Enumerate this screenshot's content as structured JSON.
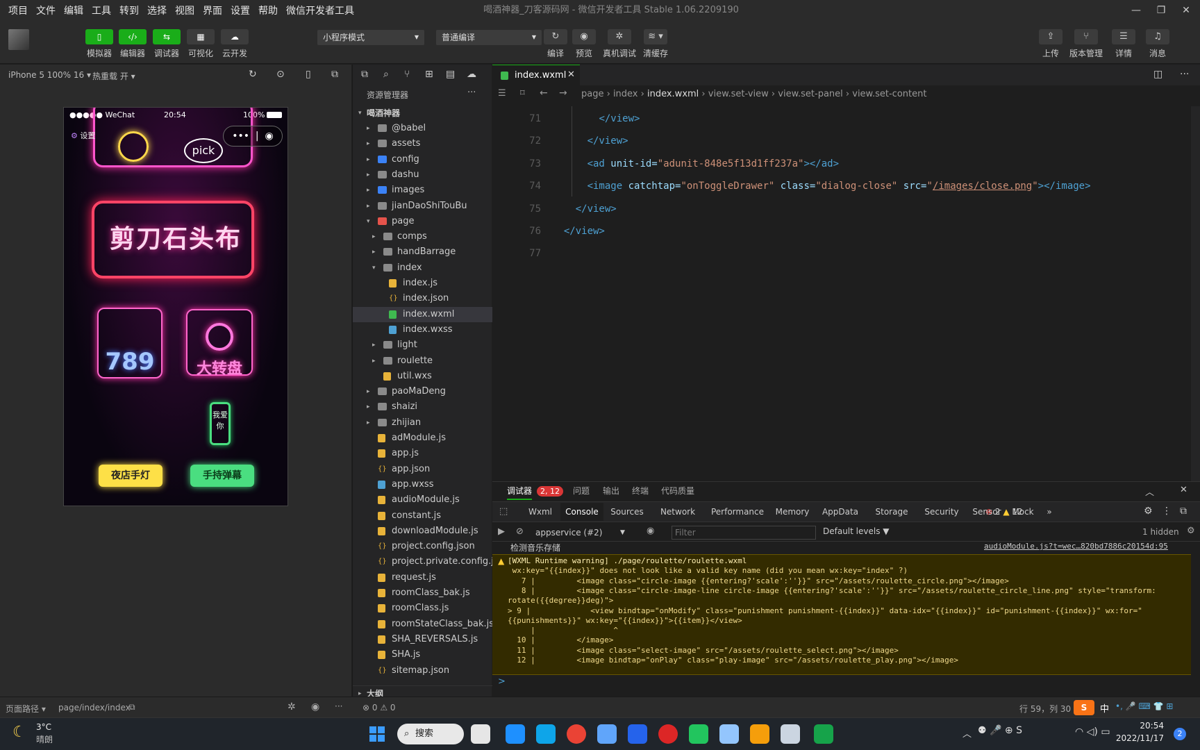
{
  "menubar": {
    "items": [
      "项目",
      "文件",
      "编辑",
      "工具",
      "转到",
      "选择",
      "视图",
      "界面",
      "设置",
      "帮助",
      "微信开发者工具"
    ]
  },
  "window": {
    "title": "喝酒神器_刀客源码网 - 微信开发者工具 Stable 1.06.2209190",
    "controls": [
      "—",
      "❐",
      "✕"
    ]
  },
  "toolbar": {
    "left_buttons": [
      {
        "label": "模拟器",
        "icon": "phone-icon",
        "color": "#1aad19"
      },
      {
        "label": "编辑器",
        "icon": "code-icon",
        "color": "#1aad19"
      },
      {
        "label": "调试器",
        "icon": "debug-icon",
        "color": "#1aad19"
      },
      {
        "label": "可视化",
        "icon": "layout-icon",
        "color": "#3c3c3c"
      },
      {
        "label": "云开发",
        "icon": "cloud-icon",
        "color": "#3c3c3c"
      }
    ],
    "mode_select": "小程序模式",
    "compile_select": "普通编译",
    "mid_buttons": [
      {
        "label": "编译",
        "icon": "refresh-icon"
      },
      {
        "label": "预览",
        "icon": "eye-icon"
      },
      {
        "label": "真机调试",
        "icon": "bug-icon"
      },
      {
        "label": "清缓存",
        "icon": "layers-icon"
      }
    ],
    "right_buttons": [
      {
        "label": "上传",
        "icon": "upload-icon"
      },
      {
        "label": "版本管理",
        "icon": "branch-icon"
      },
      {
        "label": "详情",
        "icon": "menu-icon"
      },
      {
        "label": "消息",
        "icon": "bell-icon"
      }
    ]
  },
  "simulator": {
    "device": "iPhone 5 100% 16",
    "hot_reload": "热重载 开",
    "status_carrier": "●●●●● WeChat",
    "status_time": "20:54",
    "status_battery": "100%",
    "settings_label": "设置",
    "pick_label": "pick",
    "banner_text": "剪刀石头布",
    "dice_text": "789",
    "wheel_text": "大转盘",
    "btn_light": "夜店手灯",
    "btn_barrage": "手持弹幕",
    "phone_text": "我爱你"
  },
  "explorer": {
    "title": "资源管理器",
    "more": "···",
    "root": "喝酒神器",
    "items": [
      {
        "label": "@babel",
        "type": "folder",
        "depth": 1,
        "arrow": "▸"
      },
      {
        "label": "assets",
        "type": "folder",
        "depth": 1,
        "arrow": "▸"
      },
      {
        "label": "config",
        "type": "folder-blue",
        "depth": 1,
        "arrow": "▸"
      },
      {
        "label": "dashu",
        "type": "folder",
        "depth": 1,
        "arrow": "▸"
      },
      {
        "label": "images",
        "type": "folder-blue",
        "depth": 1,
        "arrow": "▸"
      },
      {
        "label": "jianDaoShiTouBu",
        "type": "folder",
        "depth": 1,
        "arrow": "▸"
      },
      {
        "label": "page",
        "type": "folder-red",
        "depth": 1,
        "arrow": "▾"
      },
      {
        "label": "comps",
        "type": "folder",
        "depth": 2,
        "arrow": "▸"
      },
      {
        "label": "handBarrage",
        "type": "folder",
        "depth": 2,
        "arrow": "▸"
      },
      {
        "label": "index",
        "type": "folder",
        "depth": 2,
        "arrow": "▾"
      },
      {
        "label": "index.js",
        "type": "js",
        "depth": 3,
        "arrow": ""
      },
      {
        "label": "index.json",
        "type": "json",
        "depth": 3,
        "arrow": ""
      },
      {
        "label": "index.wxml",
        "type": "wxml",
        "depth": 3,
        "arrow": "",
        "selected": true
      },
      {
        "label": "index.wxss",
        "type": "wxss",
        "depth": 3,
        "arrow": ""
      },
      {
        "label": "light",
        "type": "folder",
        "depth": 2,
        "arrow": "▸"
      },
      {
        "label": "roulette",
        "type": "folder",
        "depth": 2,
        "arrow": "▸"
      },
      {
        "label": "util.wxs",
        "type": "js",
        "depth": 2,
        "arrow": ""
      },
      {
        "label": "paoMaDeng",
        "type": "folder",
        "depth": 1,
        "arrow": "▸"
      },
      {
        "label": "shaizi",
        "type": "folder",
        "depth": 1,
        "arrow": "▸"
      },
      {
        "label": "zhijian",
        "type": "folder",
        "depth": 1,
        "arrow": "▸"
      },
      {
        "label": "adModule.js",
        "type": "js",
        "depth": 1,
        "arrow": ""
      },
      {
        "label": "app.js",
        "type": "js",
        "depth": 1,
        "arrow": ""
      },
      {
        "label": "app.json",
        "type": "json",
        "depth": 1,
        "arrow": ""
      },
      {
        "label": "app.wxss",
        "type": "wxss",
        "depth": 1,
        "arrow": ""
      },
      {
        "label": "audioModule.js",
        "type": "js",
        "depth": 1,
        "arrow": ""
      },
      {
        "label": "constant.js",
        "type": "js",
        "depth": 1,
        "arrow": ""
      },
      {
        "label": "downloadModule.js",
        "type": "js",
        "depth": 1,
        "arrow": ""
      },
      {
        "label": "project.config.json",
        "type": "json",
        "depth": 1,
        "arrow": ""
      },
      {
        "label": "project.private.config.js...",
        "type": "json",
        "depth": 1,
        "arrow": ""
      },
      {
        "label": "request.js",
        "type": "js",
        "depth": 1,
        "arrow": ""
      },
      {
        "label": "roomClass_bak.js",
        "type": "js",
        "depth": 1,
        "arrow": ""
      },
      {
        "label": "roomClass.js",
        "type": "js",
        "depth": 1,
        "arrow": ""
      },
      {
        "label": "roomStateClass_bak.js",
        "type": "js",
        "depth": 1,
        "arrow": ""
      },
      {
        "label": "SHA_REVERSALS.js",
        "type": "js",
        "depth": 1,
        "arrow": ""
      },
      {
        "label": "SHA.js",
        "type": "js",
        "depth": 1,
        "arrow": ""
      },
      {
        "label": "sitemap.json",
        "type": "json",
        "depth": 1,
        "arrow": ""
      }
    ],
    "outline": "大纲"
  },
  "editor": {
    "tab": "index.wxml",
    "breadcrumb": [
      "page",
      "index",
      "index.wxml",
      "view.set-view",
      "view.set-panel",
      "view.set-content"
    ],
    "lines": [
      {
        "n": "71",
        "indent": "        ",
        "parts": [
          [
            "t",
            "</view>"
          ]
        ]
      },
      {
        "n": "72",
        "indent": "      ",
        "parts": [
          [
            "t",
            "</view>"
          ]
        ]
      },
      {
        "n": "73",
        "indent": "      ",
        "parts": [
          [
            "t",
            "<ad "
          ],
          [
            "a",
            "unit-id="
          ],
          [
            "v",
            "\"adunit-848e5f13d1ff237a\""
          ],
          [
            "t",
            "></ad>"
          ]
        ]
      },
      {
        "n": "74",
        "indent": "      ",
        "parts": [
          [
            "t",
            "<image "
          ],
          [
            "a",
            "catchtap="
          ],
          [
            "v",
            "\"onToggleDrawer\""
          ],
          [
            "a",
            " class="
          ],
          [
            "v",
            "\"dialog-close\""
          ],
          [
            "a",
            " src="
          ],
          [
            "v",
            "\""
          ],
          [
            "l",
            "/images/close.png"
          ],
          [
            "v",
            "\""
          ],
          [
            "t",
            "></image>"
          ]
        ]
      },
      {
        "n": "75",
        "indent": "    ",
        "parts": [
          [
            "t",
            "</view>"
          ]
        ]
      },
      {
        "n": "76",
        "indent": "  ",
        "parts": [
          [
            "t",
            "</view>"
          ]
        ]
      },
      {
        "n": "77",
        "indent": "",
        "parts": []
      }
    ]
  },
  "devtools": {
    "top_tabs": [
      "调试器",
      "问题",
      "输出",
      "终端",
      "代码质量"
    ],
    "badge": "2, 12",
    "panel_tabs": [
      "Wxml",
      "Console",
      "Sources",
      "Network",
      "Performance",
      "Memory",
      "AppData",
      "Storage",
      "Security",
      "Sensor",
      "Mock"
    ],
    "active_panel": "Console",
    "errors": "2",
    "warnings": "12",
    "context": "appservice (#2)",
    "filter_placeholder": "Filter",
    "levels": "Default levels",
    "hidden": "1 hidden",
    "log_text": "检测音乐存储",
    "log_source": "audioModule.js?t=wec…820bd7886c20154d:95",
    "warning_lines": [
      "[WXML Runtime warning] ./page/roulette/roulette.wxml",
      " wx:key=\"{{index}}\" does not look like a valid key name (did you mean wx:key=\"index\" ?)",
      "   7 |         <image class=\"circle-image {{entering?'scale':''}}\" src=\"/assets/roulette_circle.png\"></image>",
      "   8 |         <image class=\"circle-image-line circle-image {{entering?'scale':''}}\" src=\"/assets/roulette_circle_line.png\" style=\"transform:",
      "rotate({{degree}}deg)\">",
      "> 9 |             <view bindtap=\"onModify\" class=\"punishment punishment-{{index}}\" data-idx=\"{{index}}\" id=\"punishment-{{index}}\" wx:for=\"",
      "{{punishments}}\" wx:key=\"{{index}}\">{{item}}</view>",
      "     |                 ^",
      "  10 |         </image>",
      "  11 |         <image class=\"select-image\" src=\"/assets/roulette_select.png\"></image>",
      "  12 |         <image bindtap=\"onPlay\" class=\"play-image\" src=\"/assets/roulette_play.png\"></image>"
    ],
    "prompt": ">"
  },
  "statusbar": {
    "path_label": "页面路径",
    "path": "page/index/index",
    "problems": "⊗ 0 ⚠ 0",
    "cursor": "行 59，列 30"
  },
  "taskbar": {
    "weather_temp": "3°C",
    "weather_desc": "晴朗",
    "search": "搜索",
    "ime": "中",
    "time": "20:54",
    "date": "2022/11/17",
    "notif": "2"
  }
}
